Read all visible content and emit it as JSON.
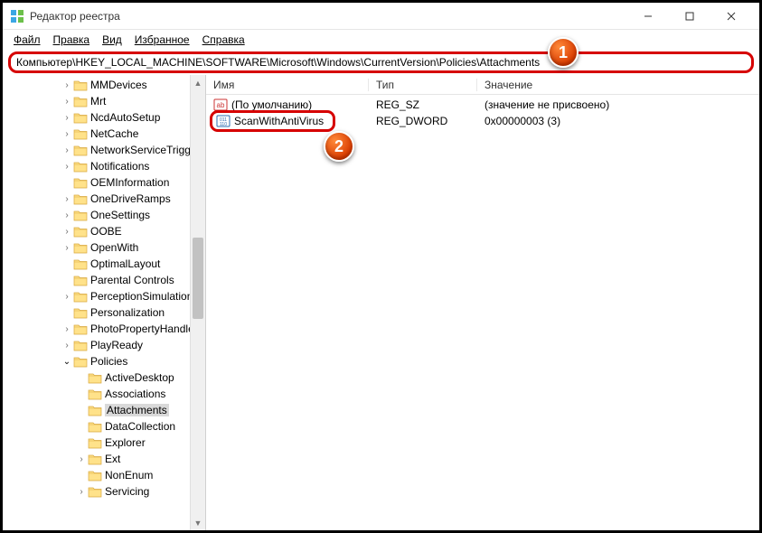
{
  "window": {
    "title": "Редактор реестра"
  },
  "menu": {
    "file": "Файл",
    "edit": "Правка",
    "view": "Вид",
    "favorites": "Избранное",
    "help": "Справка"
  },
  "address": "Компьютер\\HKEY_LOCAL_MACHINE\\SOFTWARE\\Microsoft\\Windows\\CurrentVersion\\Policies\\Attachments",
  "tree": [
    {
      "label": "MMDevices",
      "depth": 3,
      "exp": ">"
    },
    {
      "label": "Mrt",
      "depth": 3,
      "exp": ">"
    },
    {
      "label": "NcdAutoSetup",
      "depth": 3,
      "exp": ">"
    },
    {
      "label": "NetCache",
      "depth": 3,
      "exp": ">"
    },
    {
      "label": "NetworkServiceTriggers",
      "depth": 3,
      "exp": ">"
    },
    {
      "label": "Notifications",
      "depth": 3,
      "exp": ">"
    },
    {
      "label": "OEMInformation",
      "depth": 3,
      "exp": ""
    },
    {
      "label": "OneDriveRamps",
      "depth": 3,
      "exp": ">"
    },
    {
      "label": "OneSettings",
      "depth": 3,
      "exp": ">"
    },
    {
      "label": "OOBE",
      "depth": 3,
      "exp": ">"
    },
    {
      "label": "OpenWith",
      "depth": 3,
      "exp": ">"
    },
    {
      "label": "OptimalLayout",
      "depth": 3,
      "exp": ""
    },
    {
      "label": "Parental Controls",
      "depth": 3,
      "exp": ""
    },
    {
      "label": "PerceptionSimulationExtensions",
      "depth": 3,
      "exp": ">"
    },
    {
      "label": "Personalization",
      "depth": 3,
      "exp": ""
    },
    {
      "label": "PhotoPropertyHandler",
      "depth": 3,
      "exp": ">"
    },
    {
      "label": "PlayReady",
      "depth": 3,
      "exp": ">"
    },
    {
      "label": "Policies",
      "depth": 3,
      "exp": "v"
    },
    {
      "label": "ActiveDesktop",
      "depth": 4,
      "exp": ""
    },
    {
      "label": "Associations",
      "depth": 4,
      "exp": ""
    },
    {
      "label": "Attachments",
      "depth": 4,
      "exp": "",
      "selected": true
    },
    {
      "label": "DataCollection",
      "depth": 4,
      "exp": ""
    },
    {
      "label": "Explorer",
      "depth": 4,
      "exp": ""
    },
    {
      "label": "Ext",
      "depth": 4,
      "exp": ">"
    },
    {
      "label": "NonEnum",
      "depth": 4,
      "exp": ""
    },
    {
      "label": "Servicing",
      "depth": 4,
      "exp": ">"
    }
  ],
  "columns": {
    "name": "Имя",
    "type": "Тип",
    "data": "Значение"
  },
  "values": [
    {
      "icon": "sz",
      "name": "(По умолчанию)",
      "type": "REG_SZ",
      "data": "(значение не присвоено)"
    },
    {
      "icon": "dw",
      "name": "ScanWithAntiVirus",
      "type": "REG_DWORD",
      "data": "0x00000003 (3)",
      "highlighted": true
    }
  ],
  "callouts": {
    "c1": "1",
    "c2": "2"
  }
}
